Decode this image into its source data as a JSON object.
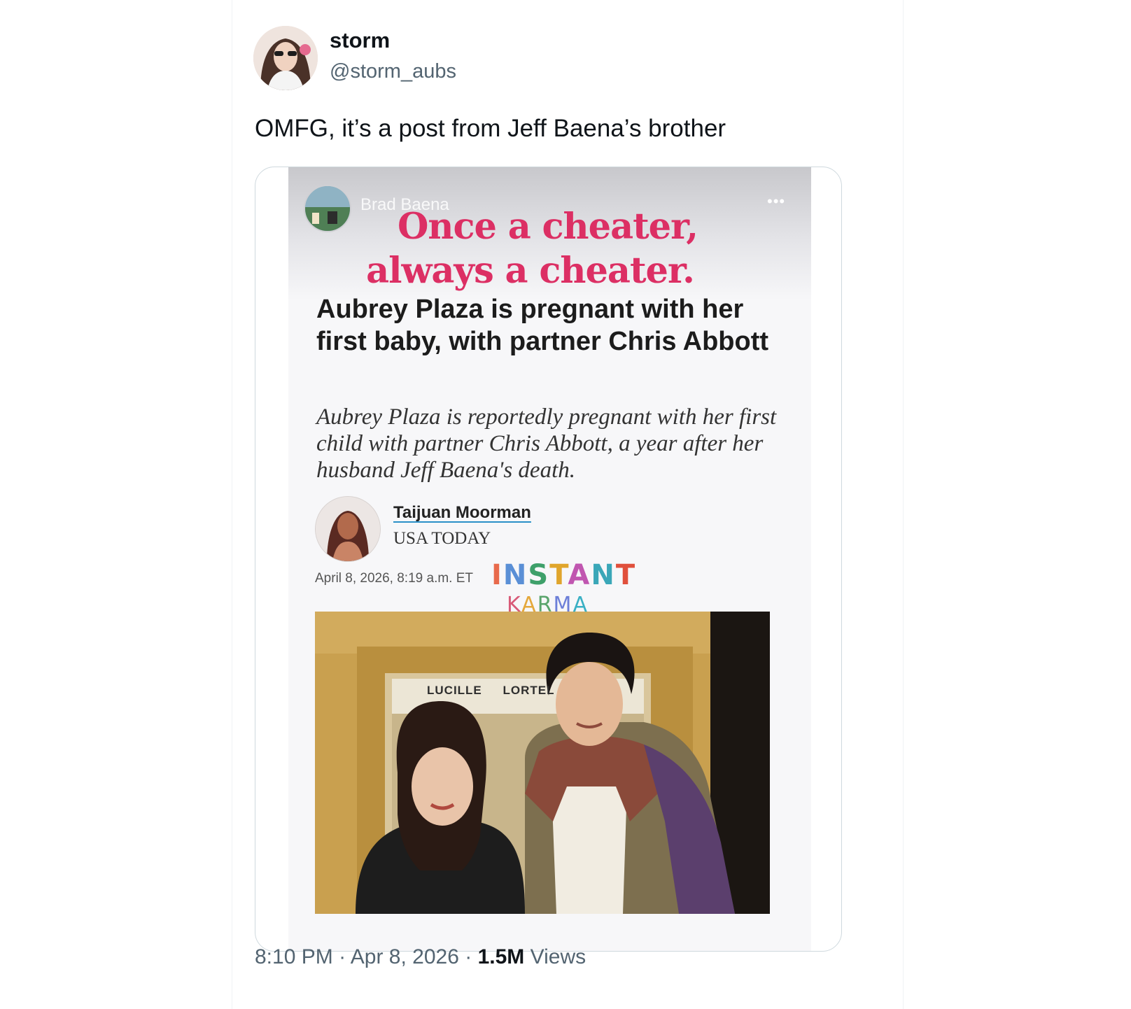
{
  "tweet": {
    "author_name": "storm",
    "author_handle": "@storm_aubs",
    "text": "OMFG, it’s a post from Jeff Baena’s brother",
    "time": "8:10 PM",
    "separator": "·",
    "date": "Apr 8, 2026",
    "views_count": "1.5M",
    "views_label": "Views"
  },
  "story": {
    "username": "Brad Baena",
    "more_icon": "more-horizontal-icon",
    "sticker_line1": "Once a cheater,",
    "sticker_line2": "always a cheater.",
    "overlay_word1": "INSTANT",
    "overlay_word2": "KARMA"
  },
  "article": {
    "headline": "Aubrey Plaza is pregnant with her first baby, with partner Chris Abbott",
    "deck": "Aubrey Plaza is reportedly pregnant with her first child with partner Chris Abbott, a year after her husband Jeff Baena's death.",
    "author": "Taijuan Moorman",
    "outlet": "USA TODAY",
    "date": "April 8, 2026, 8:19 a.m. ET",
    "photo_sign": "LUCILLE LORTEL"
  },
  "colors": {
    "sticker": "#dc2f64",
    "secondary_text": "#536471",
    "primary_text": "#0f1419",
    "border": "#cfd9de"
  }
}
